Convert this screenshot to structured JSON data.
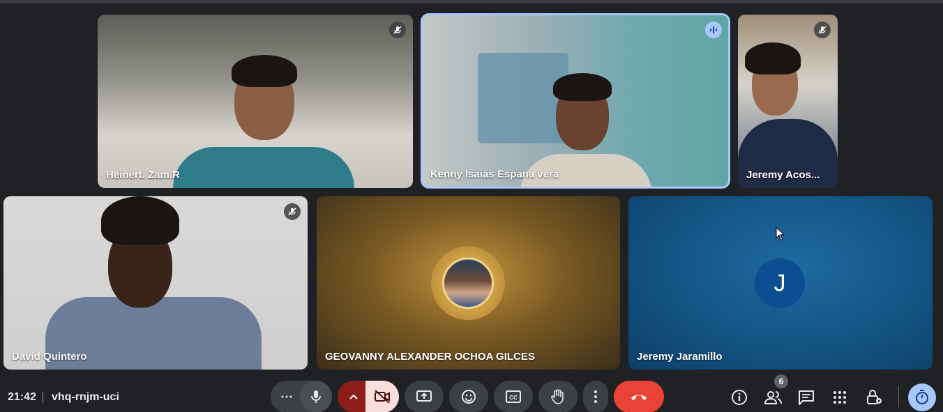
{
  "meeting": {
    "time": "21:42",
    "code": "vhq-rnjm-uci",
    "participant_count": "6"
  },
  "participants": [
    {
      "name": "Heinert. Zam.R",
      "status": "muted",
      "icon": "mic-off-icon"
    },
    {
      "name": "Kenny Isaias Espana vera",
      "status": "speaking",
      "icon": "audio-wave-icon"
    },
    {
      "name": "Jeremy Acos...",
      "status": "muted",
      "icon": "mic-off-icon"
    },
    {
      "name": "David Quintero",
      "status": "muted",
      "icon": "mic-off-icon"
    },
    {
      "name": "GEOVANNY ALEXANDER OCHOA GILCES",
      "status": "camera-off",
      "icon": "avatar-photo"
    },
    {
      "name": "Jeremy Jaramillo",
      "status": "camera-off",
      "initial": "J"
    }
  ],
  "controls": [
    {
      "name": "more-options",
      "icon": "more-horizontal-icon"
    },
    {
      "name": "microphone",
      "icon": "mic-icon"
    },
    {
      "name": "camera-options",
      "icon": "chevron-up-icon"
    },
    {
      "name": "camera",
      "icon": "camera-off-icon"
    },
    {
      "name": "present",
      "icon": "present-screen-icon"
    },
    {
      "name": "reactions",
      "icon": "emoji-icon"
    },
    {
      "name": "captions",
      "icon": "captions-icon"
    },
    {
      "name": "raise-hand",
      "icon": "hand-icon"
    },
    {
      "name": "more",
      "icon": "more-vertical-icon"
    },
    {
      "name": "leave-call",
      "icon": "phone-hangup-icon"
    }
  ],
  "right_controls": [
    "info-icon",
    "people-icon",
    "chat-icon",
    "apps-icon",
    "host-controls-icon",
    "timer-icon"
  ],
  "colors": {
    "end_call": "#ea4335",
    "speaking_outline": "#a8c7fa",
    "camera_off_bg": "#f9dedc",
    "initial_avatar": "#0b4f92"
  }
}
